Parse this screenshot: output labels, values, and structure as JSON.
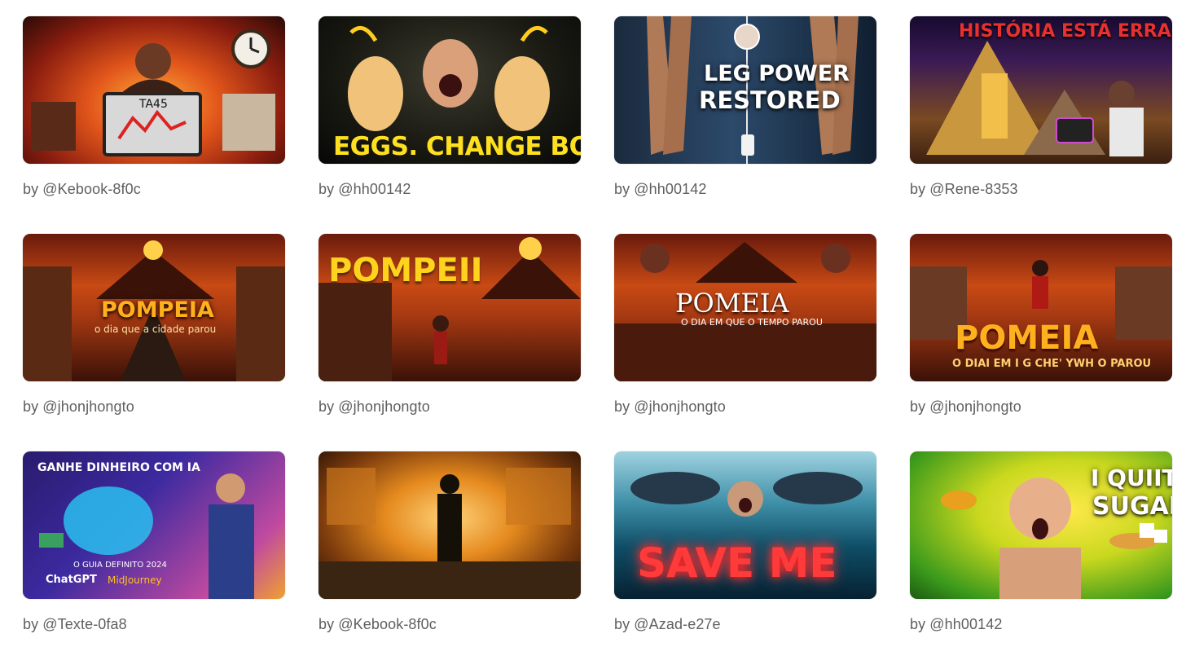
{
  "cards": [
    {
      "author": "by @Kebook-8f0c",
      "thumb_text": "TA45",
      "accent": "#e2561b"
    },
    {
      "author": "by @hh00142",
      "thumb_text": "EGGS. CHANGE BODY",
      "accent": "#ffe01e"
    },
    {
      "author": "by @hh00142",
      "thumb_text_1": "LEG POWER",
      "thumb_text_2": "RESTORED",
      "accent": "#ffd21e"
    },
    {
      "author": "by @Rene-8353",
      "thumb_text": "HISTÓRIA ESTÁ ERRADA",
      "accent": "#e83030"
    },
    {
      "author": "by @jhonjhongto",
      "thumb_text": "POMPEIA",
      "thumb_sub": "o dia que a cidade parou",
      "accent": "#ffb01e"
    },
    {
      "author": "by @jhonjhongto",
      "thumb_text": "POMPEII",
      "accent": "#ffd21e"
    },
    {
      "author": "by @jhonjhongto",
      "thumb_text": "POMEIA",
      "thumb_sub": "O DIA EM QUE O TEMPO PAROU",
      "accent": "#ffffff"
    },
    {
      "author": "by @jhonjhongto",
      "thumb_text": "POMEIA",
      "thumb_sub": "O DIAI EM I G CHE' YWH O PAROU",
      "accent": "#ffb01e"
    },
    {
      "author": "by @Texte-0fa8",
      "thumb_text": "GANHE DINHEIRO COM IA",
      "thumb_sub": "O GUIA DEFINITO 2024",
      "thumb_brand_1": "ChatGPT",
      "thumb_brand_2": "MidJourney",
      "accent": "#ffffff"
    },
    {
      "author": "by @Kebook-8f0c",
      "accent": "#e58a1e"
    },
    {
      "author": "by @Azad-e27e",
      "thumb_text": "SAVE ME",
      "accent": "#ff3030"
    },
    {
      "author": "by @hh00142",
      "thumb_text_1": "I QUIIT",
      "thumb_text_2": "SUGAR!",
      "accent": "#ffffff"
    }
  ]
}
